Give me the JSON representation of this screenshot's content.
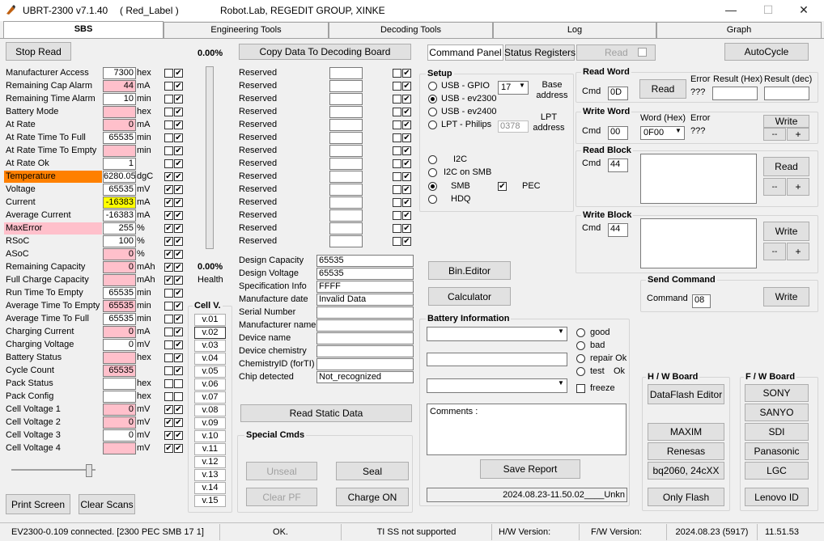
{
  "window": {
    "title": "UBRT-2300 v7.1.40",
    "label": "( Red_Label )",
    "company": "Robot.Lab,  REGEDIT GROUP,  XINKE",
    "minimize": "—",
    "maximize": "☐",
    "close": "✕"
  },
  "tabs": [
    "SBS",
    "Engineering Tools",
    "Decoding Tools",
    "Log",
    "Graph"
  ],
  "sbs": {
    "stop_read": "Stop Read",
    "registers": [
      {
        "name": "Manufacturer Access",
        "value": "7300",
        "unit": "hex",
        "bg": "#ffffff",
        "lbg": "",
        "c1": false,
        "c2": true
      },
      {
        "name": "Remaining Cap Alarm",
        "value": "44",
        "unit": "mA",
        "bg": "#ffc0cb",
        "lbg": "",
        "c1": false,
        "c2": true
      },
      {
        "name": "Remaining Time Alarm",
        "value": "10",
        "unit": "min",
        "bg": "#ffffff",
        "lbg": "",
        "c1": false,
        "c2": true
      },
      {
        "name": "Battery Mode",
        "value": "",
        "unit": "hex",
        "bg": "#ffc0cb",
        "lbg": "",
        "c1": false,
        "c2": true
      },
      {
        "name": "At Rate",
        "value": "0",
        "unit": "mA",
        "bg": "#ffc0cb",
        "lbg": "",
        "c1": false,
        "c2": true
      },
      {
        "name": "At Rate Time To Full",
        "value": "65535",
        "unit": "min",
        "bg": "#ffffff",
        "lbg": "",
        "c1": false,
        "c2": true
      },
      {
        "name": "At Rate Time To Empty",
        "value": "",
        "unit": "min",
        "bg": "#ffc0cb",
        "lbg": "",
        "c1": false,
        "c2": true
      },
      {
        "name": "At Rate Ok",
        "value": "1",
        "unit": "",
        "bg": "#ffffff",
        "lbg": "",
        "c1": false,
        "c2": true
      },
      {
        "name": "Temperature",
        "value": "6280.05",
        "unit": "dgC",
        "bg": "#ffffff",
        "lbg": "#ff8000",
        "c1": true,
        "c2": true
      },
      {
        "name": "Voltage",
        "value": "65535",
        "unit": "mV",
        "bg": "#ffffff",
        "lbg": "",
        "c1": true,
        "c2": true
      },
      {
        "name": "Current",
        "value": "-16383",
        "unit": "mA",
        "bg": "#ffff00",
        "lbg": "",
        "c1": true,
        "c2": true
      },
      {
        "name": "Average Current",
        "value": "-16383",
        "unit": "mA",
        "bg": "#ffffff",
        "lbg": "",
        "c1": true,
        "c2": true
      },
      {
        "name": "MaxError",
        "value": "255",
        "unit": "%",
        "bg": "#ffffff",
        "lbg": "#ffc0cb",
        "c1": true,
        "c2": true
      },
      {
        "name": "RSoC",
        "value": "100",
        "unit": "%",
        "bg": "#ffffff",
        "lbg": "",
        "c1": true,
        "c2": true
      },
      {
        "name": "ASoC",
        "value": "0",
        "unit": "%",
        "bg": "#ffc0cb",
        "lbg": "",
        "c1": true,
        "c2": true
      },
      {
        "name": "Remaining Capacity",
        "value": "0",
        "unit": "mAh",
        "bg": "#ffc0cb",
        "lbg": "",
        "c1": true,
        "c2": true
      },
      {
        "name": "Full Charge Capacity",
        "value": "",
        "unit": "mAh",
        "bg": "#ffc0cb",
        "lbg": "",
        "c1": true,
        "c2": true
      },
      {
        "name": "Run Time To Empty",
        "value": "65535",
        "unit": "min",
        "bg": "#ffffff",
        "lbg": "",
        "c1": false,
        "c2": true
      },
      {
        "name": "Average Time To Empty",
        "value": "65535",
        "unit": "min",
        "bg": "#ffc0cb",
        "lbg": "",
        "c1": false,
        "c2": true
      },
      {
        "name": "Average Time To Full",
        "value": "65535",
        "unit": "min",
        "bg": "#ffffff",
        "lbg": "",
        "c1": false,
        "c2": true
      },
      {
        "name": "Charging Current",
        "value": "0",
        "unit": "mA",
        "bg": "#ffc0cb",
        "lbg": "",
        "c1": false,
        "c2": true
      },
      {
        "name": "Charging Voltage",
        "value": "0",
        "unit": "mV",
        "bg": "#ffffff",
        "lbg": "",
        "c1": false,
        "c2": true
      },
      {
        "name": "Battery Status",
        "value": "",
        "unit": "hex",
        "bg": "#ffc0cb",
        "lbg": "",
        "c1": false,
        "c2": true
      },
      {
        "name": "Cycle Count",
        "value": "65535",
        "unit": "",
        "bg": "#ffc0cb",
        "lbg": "",
        "c1": false,
        "c2": true
      },
      {
        "name": "Pack Status",
        "value": "",
        "unit": "hex",
        "bg": "#ffffff",
        "lbg": "",
        "c1": false,
        "c2": false
      },
      {
        "name": "Pack Config",
        "value": "",
        "unit": "hex",
        "bg": "#ffffff",
        "lbg": "",
        "c1": false,
        "c2": false
      },
      {
        "name": "Cell Voltage 1",
        "value": "0",
        "unit": "mV",
        "bg": "#ffc0cb",
        "lbg": "",
        "c1": true,
        "c2": true
      },
      {
        "name": "Cell Voltage 2",
        "value": "0",
        "unit": "mV",
        "bg": "#ffc0cb",
        "lbg": "",
        "c1": true,
        "c2": true
      },
      {
        "name": "Cell Voltage 3",
        "value": "0",
        "unit": "mV",
        "bg": "#ffffff",
        "lbg": "",
        "c1": true,
        "c2": true
      },
      {
        "name": "Cell Voltage 4",
        "value": "",
        "unit": "mV",
        "bg": "#ffc0cb",
        "lbg": "",
        "c1": true,
        "c2": true
      }
    ],
    "print_screen": "Print Screen",
    "clear_scans": "Clear Scans",
    "percent_top": "0.00%",
    "percent_health": "0.00%",
    "health_label": "Health",
    "cellv_title": "Cell V.",
    "cellv": [
      "v.01",
      "v.02",
      "v.03",
      "v.04",
      "v.05",
      "v.06",
      "v.07",
      "v.08",
      "v.09",
      "v.10",
      "v.11",
      "v.12",
      "v.13",
      "v.14",
      "v.15"
    ],
    "copy_button": "Copy Data To Decoding Board",
    "reserved_label": "Reserved",
    "reserved_count": 14,
    "static": [
      {
        "name": "Design Capacity",
        "value": "65535"
      },
      {
        "name": "Design Voltage",
        "value": "65535"
      },
      {
        "name": "Specification Info",
        "value": "FFFF"
      },
      {
        "name": "Manufacture date",
        "value": " Invalid Data"
      },
      {
        "name": "Serial Number",
        "value": ""
      },
      {
        "name": "Manufacturer name",
        "value": ""
      },
      {
        "name": "Device name",
        "value": ""
      },
      {
        "name": "Device chemistry",
        "value": ""
      },
      {
        "name": "ChemistryID (forTI)",
        "value": ""
      },
      {
        "name": "Chip detected",
        "value": "Not_recognized"
      }
    ],
    "read_static": "Read Static Data",
    "special_cmds": {
      "title": "Special Cmds",
      "unseal": "Unseal",
      "seal": "Seal",
      "clear_pf": "Clear PF",
      "charge_on": "Charge ON"
    }
  },
  "right": {
    "command_panel": "Command Panel",
    "status_registers": "Status Registers",
    "read": "Read",
    "autocycle": "AutoCycle",
    "setup": {
      "title": "Setup",
      "usb_gpio": "USB - GPIO",
      "usb_ev2300": "USB - ev2300",
      "usb_ev2400": "USB - ev2400",
      "lpt": "LPT  - Philips",
      "port": "17",
      "lpt_addr": "0378",
      "base_address": "Base address",
      "lpt_address": "LPT address",
      "i2c": "I2C",
      "i2c_smb": "I2C on SMB",
      "smb": "SMB",
      "hdq": "HDQ",
      "pec": "PEC"
    },
    "bin_editor": "Bin.Editor",
    "calculator": "Calculator",
    "read_word": {
      "title": "Read Word",
      "cmd_label": "Cmd",
      "cmd": "0D",
      "read": "Read",
      "error": "Error",
      "error_val": "???",
      "result_hex": "Result (Hex)",
      "result_dec": "Result (dec)"
    },
    "write_word": {
      "title": "Write Word",
      "cmd_label": "Cmd",
      "cmd": "00",
      "word_hex": "Word (Hex)",
      "word": "0F00",
      "error": "Error",
      "error_val": "???",
      "write": "Write",
      "minus": "--",
      "plus": "+"
    },
    "read_block": {
      "title": "Read Block",
      "cmd_label": "Cmd",
      "cmd": "44",
      "read": "Read",
      "minus": "--",
      "plus": "+"
    },
    "write_block": {
      "title": "Write Block",
      "cmd_label": "Cmd",
      "cmd": "44",
      "write": "Write",
      "minus": "--",
      "plus": "+"
    },
    "send_command": {
      "title": "Send Command",
      "cmd_label": "Command",
      "cmd": "08",
      "write": "Write"
    },
    "battery_info": {
      "title": "Battery Information",
      "good": "good",
      "bad": "bad",
      "repair": "repair Ok",
      "test": "test",
      "ok": "Ok",
      "freeze": "freeze",
      "comments": "Comments :",
      "save_report": "Save Report",
      "report_stamp": "2024.08.23-11.50.02____Unkn"
    },
    "hw_board": {
      "title": "H / W   Board",
      "items": [
        "DataFlash Editor",
        "MAXIM",
        "Renesas",
        "bq2060, 24cXX",
        "Only Flash"
      ]
    },
    "fw_board": {
      "title": "F / W   Board",
      "items": [
        "SONY",
        "SANYO",
        "SDI",
        "Panasonic",
        "LGC",
        "Lenovo ID"
      ]
    }
  },
  "status": {
    "connection": "EV2300-0.109 connected. [2300  PEC  SMB  17 1]",
    "ok": "OK.",
    "ti": "TI SS not supported",
    "hw": "H/W Version:",
    "fw": "F/W Version:",
    "date": "2024.08.23  (5917)",
    "time": "11.51.53"
  }
}
